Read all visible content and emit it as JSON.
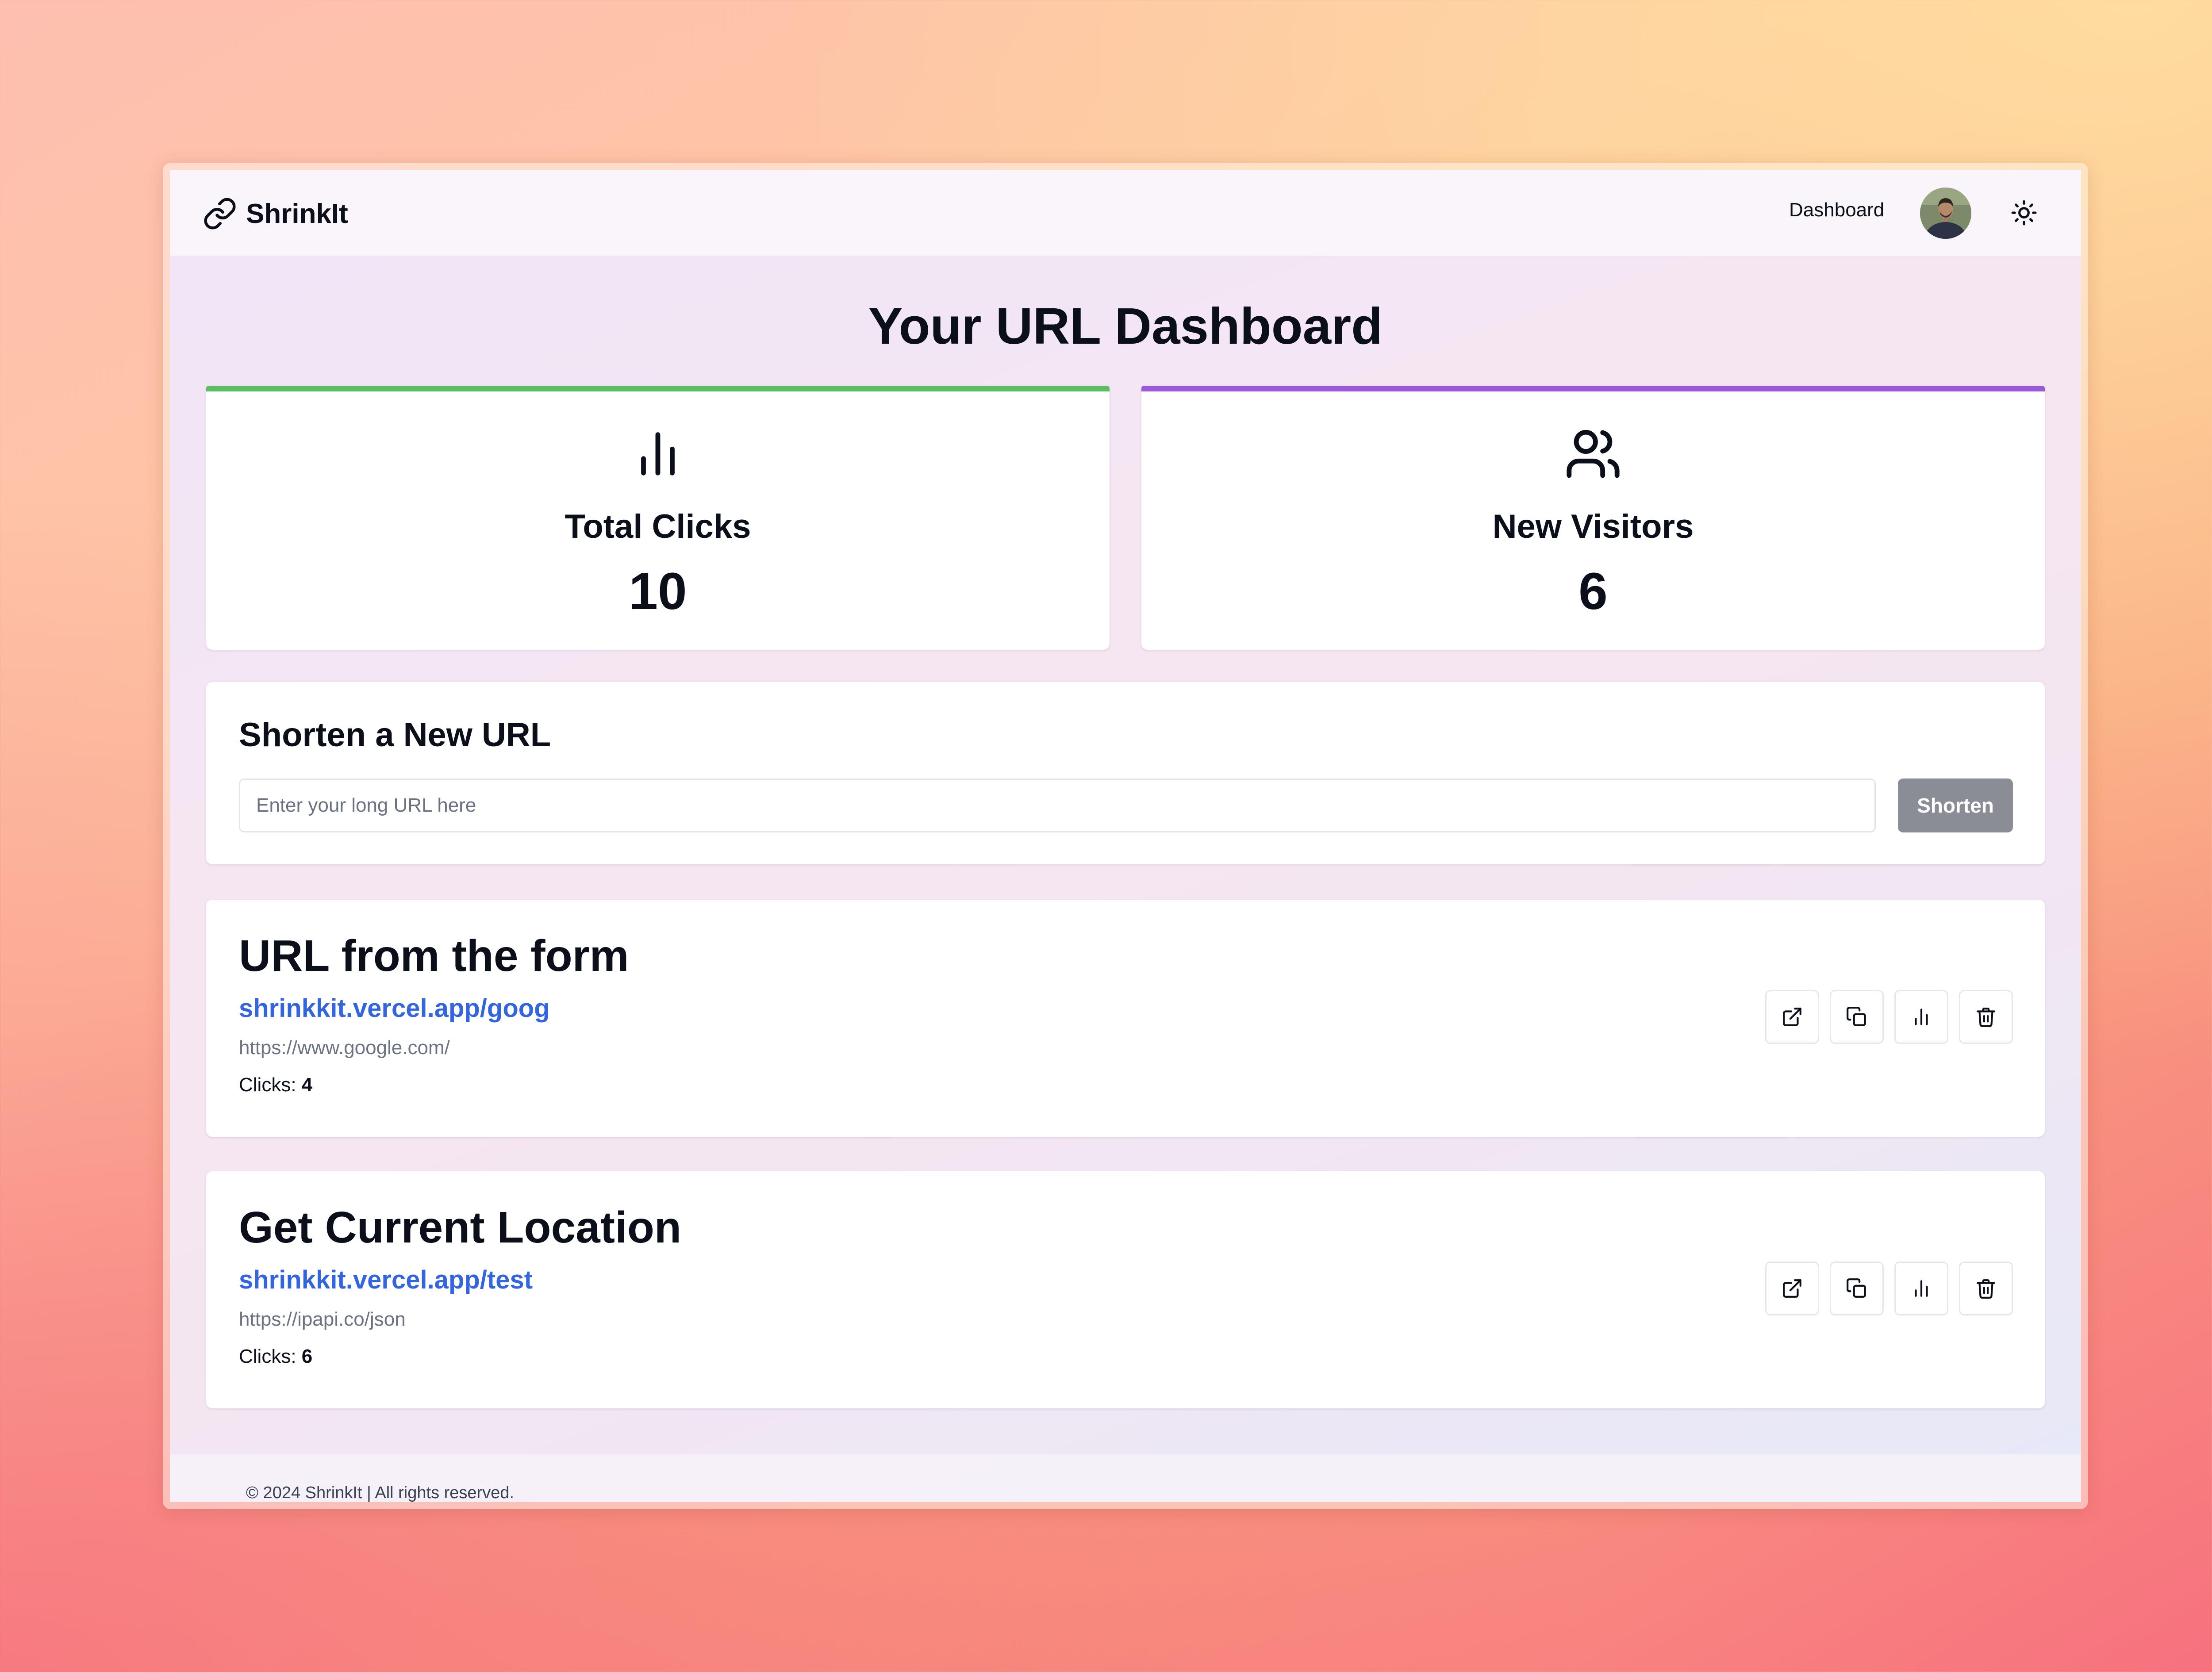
{
  "app": {
    "name": "ShrinkIt"
  },
  "nav": {
    "dashboard_label": "Dashboard"
  },
  "page": {
    "title": "Your URL Dashboard"
  },
  "stats": [
    {
      "label": "Total Clicks",
      "value": "10",
      "accent": "#5cbd64",
      "icon": "bar-chart-icon"
    },
    {
      "label": "New Visitors",
      "value": "6",
      "accent": "#9b59d9",
      "icon": "users-icon"
    }
  ],
  "shorten_form": {
    "title": "Shorten a New URL",
    "input_value": "",
    "input_placeholder": "Enter your long URL here",
    "button_label": "Shorten"
  },
  "urls": [
    {
      "title": "URL from the form",
      "short": "shrinkkit.vercel.app/goog",
      "original": "https://www.google.com/",
      "clicks_label": "Clicks:",
      "clicks": "4"
    },
    {
      "title": "Get Current Location",
      "short": "shrinkkit.vercel.app/test",
      "original": "https://ipapi.co/json",
      "clicks_label": "Clicks:",
      "clicks": "6"
    }
  ],
  "footer": {
    "text": "© 2024 ShrinkIt | All rights reserved."
  },
  "colors": {
    "link": "#3466d9",
    "disabled_button": "#8a8d96",
    "total_clicks_accent": "#5cbd64",
    "new_visitors_accent": "#9b59d9"
  }
}
